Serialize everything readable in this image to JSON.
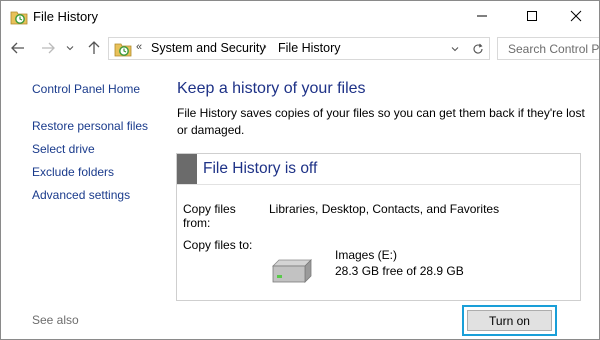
{
  "window": {
    "title": "File History",
    "icons": {
      "app": "file-history-icon",
      "minimize": "minimize-icon",
      "maximize": "maximize-icon",
      "close": "close-icon"
    }
  },
  "nav": {
    "back_icon": "arrow-left-icon",
    "forward_icon": "arrow-right-icon",
    "dropdown_icon": "chevron-down-icon",
    "up_icon": "arrow-up-icon",
    "overflow_marker": "«",
    "breadcrumbs": [
      "System and Security",
      "File History"
    ],
    "separator": "›",
    "refresh_icon": "refresh-icon",
    "search_placeholder": "Search Control P"
  },
  "sidebar": {
    "home": "Control Panel Home",
    "items": [
      "Restore personal files",
      "Select drive",
      "Exclude folders",
      "Advanced settings"
    ],
    "see_also": "See also"
  },
  "main": {
    "title": "Keep a history of your files",
    "description": "File History saves copies of your files so you can get them back if they're lost or damaged.",
    "panel": {
      "status": "File History is off",
      "copy_from_label": "Copy files from:",
      "copy_from_value": "Libraries, Desktop, Contacts, and Favorites",
      "copy_to_label": "Copy files to:",
      "drive_icon": "hard-drive-icon",
      "drive_name": "Images (E:)",
      "drive_space": "28.3 GB free of 28.9 GB"
    },
    "turn_on_label": "Turn on"
  },
  "colors": {
    "link": "#1a3b8c",
    "heading": "#1e3287",
    "status_bar": "#6b6b6b",
    "focus_ring": "#1a9fd8"
  }
}
